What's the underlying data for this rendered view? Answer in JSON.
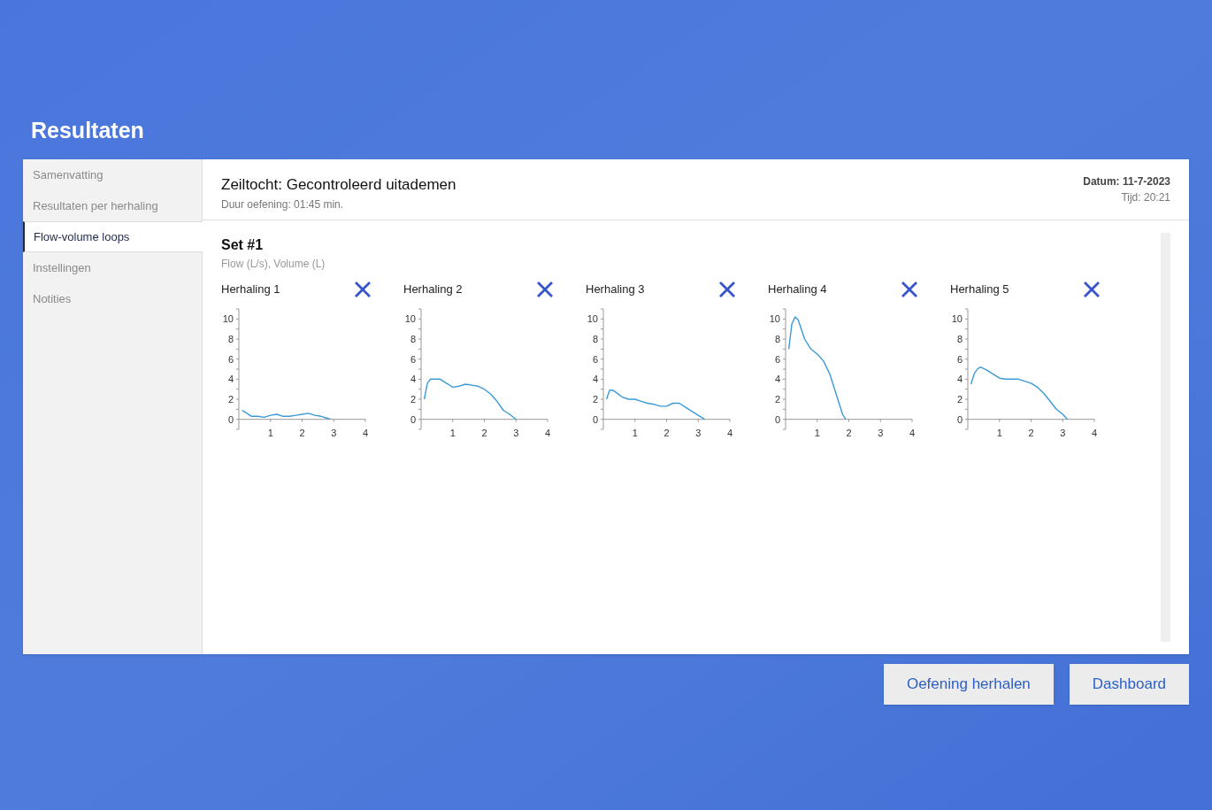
{
  "page_title": "Resultaten",
  "sidebar": {
    "items": [
      {
        "label": "Samenvatting",
        "selected": false
      },
      {
        "label": "Resultaten per herhaling",
        "selected": false
      },
      {
        "label": "Flow-volume loops",
        "selected": true
      },
      {
        "label": "Instellingen",
        "selected": false
      },
      {
        "label": "Notities",
        "selected": false
      }
    ]
  },
  "header": {
    "title": "Zeiltocht: Gecontroleerd uitademen",
    "duration": "Duur oefening: 01:45 min.",
    "date": "Datum: 11-7-2023",
    "time": "Tijd: 20:21"
  },
  "set": {
    "title": "Set #1",
    "units": "Flow (L/s), Volume (L)",
    "charts": [
      {
        "chart_data": {
          "type": "line",
          "x": [
            0.1,
            0.2,
            0.4,
            0.6,
            0.8,
            1,
            1.2,
            1.4,
            1.6,
            1.8,
            2,
            2.2,
            2.4,
            2.6,
            2.8,
            2.9
          ],
          "xlim": [
            0,
            4
          ],
          "ylim": [
            -1,
            11
          ],
          "xticks": [
            1,
            2,
            3,
            4
          ],
          "yticks": [
            0,
            2,
            4,
            6,
            8,
            10
          ],
          "series": [
            {
              "name": "Herhaling 1",
              "color": "#3b9ad6",
              "values": [
                0.9,
                0.7,
                0.3,
                0.3,
                0.2,
                0.4,
                0.5,
                0.3,
                0.3,
                0.4,
                0.5,
                0.6,
                0.4,
                0.3,
                0.1,
                0
              ]
            }
          ]
        }
      },
      {
        "chart_data": {
          "type": "line",
          "x": [
            0.1,
            0.2,
            0.3,
            0.4,
            0.6,
            0.8,
            1,
            1.2,
            1.4,
            1.6,
            1.8,
            2,
            2.2,
            2.4,
            2.6,
            2.8,
            3
          ],
          "xlim": [
            0,
            4
          ],
          "ylim": [
            -1,
            11
          ],
          "xticks": [
            1,
            2,
            3,
            4
          ],
          "yticks": [
            0,
            2,
            4,
            6,
            8,
            10
          ],
          "series": [
            {
              "name": "Herhaling 2",
              "color": "#3b9ad6",
              "values": [
                2,
                3.6,
                4,
                4,
                4,
                3.6,
                3.2,
                3.3,
                3.5,
                3.4,
                3.3,
                3,
                2.5,
                1.8,
                0.9,
                0.5,
                0
              ]
            }
          ]
        }
      },
      {
        "chart_data": {
          "type": "line",
          "x": [
            0.1,
            0.2,
            0.3,
            0.4,
            0.6,
            0.8,
            1,
            1.2,
            1.4,
            1.6,
            1.8,
            2,
            2.2,
            2.4,
            2.6,
            2.8,
            3,
            3.2
          ],
          "xlim": [
            0,
            4
          ],
          "ylim": [
            -1,
            11
          ],
          "xticks": [
            1,
            2,
            3,
            4
          ],
          "yticks": [
            0,
            2,
            4,
            6,
            8,
            10
          ],
          "series": [
            {
              "name": "Herhaling 3",
              "color": "#3b9ad6",
              "values": [
                2,
                2.9,
                2.9,
                2.7,
                2.2,
                2,
                2,
                1.8,
                1.6,
                1.5,
                1.3,
                1.3,
                1.6,
                1.6,
                1.2,
                0.8,
                0.4,
                0
              ]
            }
          ]
        }
      },
      {
        "chart_data": {
          "type": "line",
          "x": [
            0.1,
            0.2,
            0.3,
            0.4,
            0.6,
            0.8,
            1,
            1.2,
            1.4,
            1.6,
            1.8,
            1.9
          ],
          "xlim": [
            0,
            4
          ],
          "ylim": [
            -1,
            11
          ],
          "xticks": [
            1,
            2,
            3,
            4
          ],
          "yticks": [
            0,
            2,
            4,
            6,
            8,
            10
          ],
          "series": [
            {
              "name": "Herhaling 4",
              "color": "#3b9ad6",
              "values": [
                7,
                9.5,
                10.2,
                9.9,
                8,
                7,
                6.5,
                5.8,
                4.5,
                2.5,
                0.5,
                0
              ]
            }
          ]
        }
      },
      {
        "chart_data": {
          "type": "line",
          "x": [
            0.1,
            0.2,
            0.3,
            0.4,
            0.6,
            0.8,
            1,
            1.2,
            1.4,
            1.6,
            1.8,
            2,
            2.2,
            2.4,
            2.6,
            2.8,
            3,
            3.15
          ],
          "xlim": [
            0,
            4
          ],
          "ylim": [
            -1,
            11
          ],
          "xticks": [
            1,
            2,
            3,
            4
          ],
          "yticks": [
            0,
            2,
            4,
            6,
            8,
            10
          ],
          "series": [
            {
              "name": "Herhaling 5",
              "color": "#3b9ad6",
              "values": [
                3.5,
                4.5,
                5,
                5.2,
                4.9,
                4.5,
                4.1,
                4,
                4,
                4,
                3.8,
                3.6,
                3.2,
                2.6,
                1.8,
                1,
                0.5,
                0
              ]
            }
          ]
        }
      }
    ]
  },
  "buttons": [
    {
      "label": "Oefening herhalen"
    },
    {
      "label": "Dashboard"
    }
  ]
}
